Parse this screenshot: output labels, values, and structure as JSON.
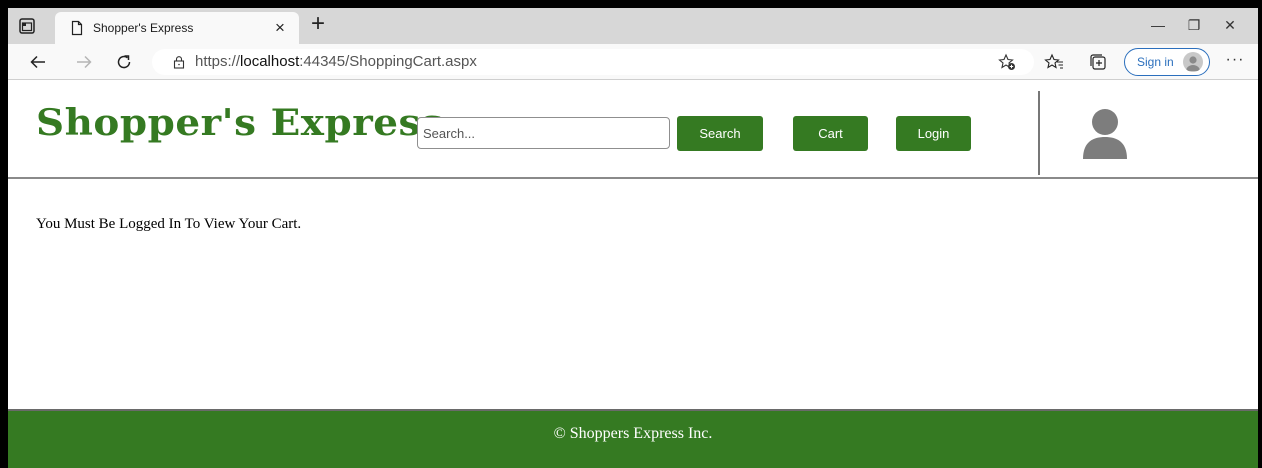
{
  "browser": {
    "tab_title": "Shopper's Express",
    "tab_close": "×",
    "new_tab": "+",
    "url_prefix": "https://",
    "url_host": "localhost",
    "url_rest": ":44345/ShoppingCart.aspx",
    "signin_label": "Sign in",
    "more": "···",
    "window_controls": {
      "minimize": "—",
      "restore": "❐",
      "close": "✕"
    },
    "icons": [
      "tab-actions-icon",
      "page-icon",
      "back-arrow-icon",
      "forward-arrow-icon",
      "refresh-icon",
      "lock-icon",
      "add-favorite-icon",
      "favorites-icon",
      "collections-icon",
      "profile-avatar-icon"
    ]
  },
  "header": {
    "brand": "Shopper's Express",
    "search_placeholder": "Search...",
    "search_label": "Search",
    "cart_label": "Cart",
    "login_label": "Login"
  },
  "main": {
    "message": "You Must Be Logged In To View Your Cart."
  },
  "footer": {
    "copyright": "© Shoppers Express Inc."
  },
  "colors": {
    "brand_green": "#357a22",
    "signin_blue": "#2b6fbd"
  }
}
